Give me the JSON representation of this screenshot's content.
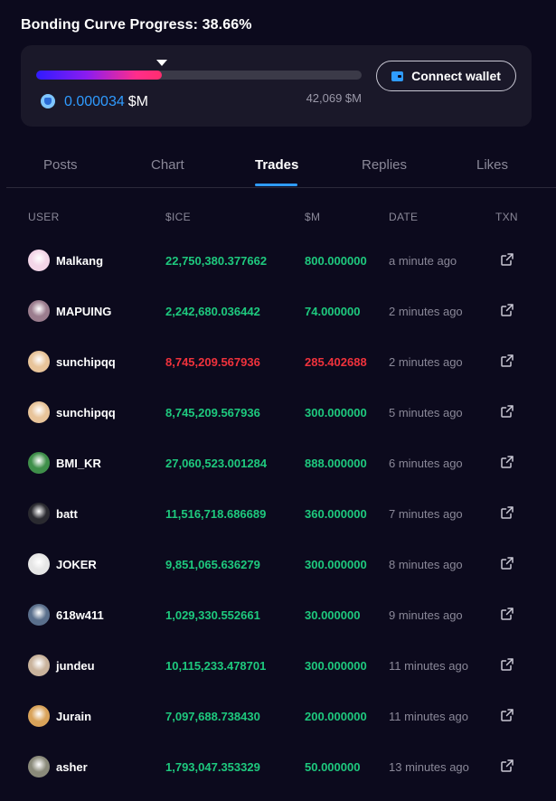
{
  "progress": {
    "title": "Bonding Curve Progress: 38.66%",
    "percent": 38.66,
    "current_value": "0.000034",
    "current_unit": "$M",
    "max_value": "42,069 $M",
    "connect_label": "Connect wallet"
  },
  "tabs": [
    {
      "label": "Posts"
    },
    {
      "label": "Chart"
    },
    {
      "label": "Trades",
      "active": true
    },
    {
      "label": "Replies"
    },
    {
      "label": "Likes"
    }
  ],
  "table": {
    "headers": [
      "USER",
      "$ICE",
      "$M",
      "DATE",
      "TXN"
    ],
    "rows": [
      {
        "user": "Malkang",
        "ice": "22,750,380.377662",
        "m": "800.000000",
        "date": "a minute ago",
        "type": "buy",
        "avatar": "#f3d6e8"
      },
      {
        "user": "MAPUING",
        "ice": "2,242,680.036442",
        "m": "74.000000",
        "date": "2 minutes ago",
        "type": "buy",
        "avatar": "#9b7d8e"
      },
      {
        "user": "sunchipqq",
        "ice": "8,745,209.567936",
        "m": "285.402688",
        "date": "2 minutes ago",
        "type": "sell",
        "avatar": "#e8c49a"
      },
      {
        "user": "sunchipqq",
        "ice": "8,745,209.567936",
        "m": "300.000000",
        "date": "5 minutes ago",
        "type": "buy",
        "avatar": "#e8c49a"
      },
      {
        "user": "BMI_KR",
        "ice": "27,060,523.001284",
        "m": "888.000000",
        "date": "6 minutes ago",
        "type": "buy",
        "avatar": "#3f8f4a"
      },
      {
        "user": "batt",
        "ice": "11,516,718.686689",
        "m": "360.000000",
        "date": "7 minutes ago",
        "type": "buy",
        "avatar": "#2a2a30"
      },
      {
        "user": "JOKER",
        "ice": "9,851,065.636279",
        "m": "300.000000",
        "date": "8 minutes ago",
        "type": "buy",
        "avatar": "#e6e6e6"
      },
      {
        "user": "618w411",
        "ice": "1,029,330.552661",
        "m": "30.000000",
        "date": "9 minutes ago",
        "type": "buy",
        "avatar": "#5a6f8c"
      },
      {
        "user": "jundeu",
        "ice": "10,115,233.478701",
        "m": "300.000000",
        "date": "11 minutes ago",
        "type": "buy",
        "avatar": "#c9b39c"
      },
      {
        "user": "Jurain",
        "ice": "7,097,688.738430",
        "m": "200.000000",
        "date": "11 minutes ago",
        "type": "buy",
        "avatar": "#d9a35a"
      },
      {
        "user": "asher",
        "ice": "1,793,047.353329",
        "m": "50.000000",
        "date": "13 minutes ago",
        "type": "buy",
        "avatar": "#8a8a7a"
      }
    ]
  },
  "colors": {
    "accent": "#2f9bff",
    "buy": "#1ec97e",
    "sell": "#f0323c",
    "background": "#0c0a1d",
    "card": "#1a1829"
  },
  "icons": {
    "coin": "coin-icon",
    "wallet": "wallet-icon",
    "txn": "external-link-icon"
  }
}
